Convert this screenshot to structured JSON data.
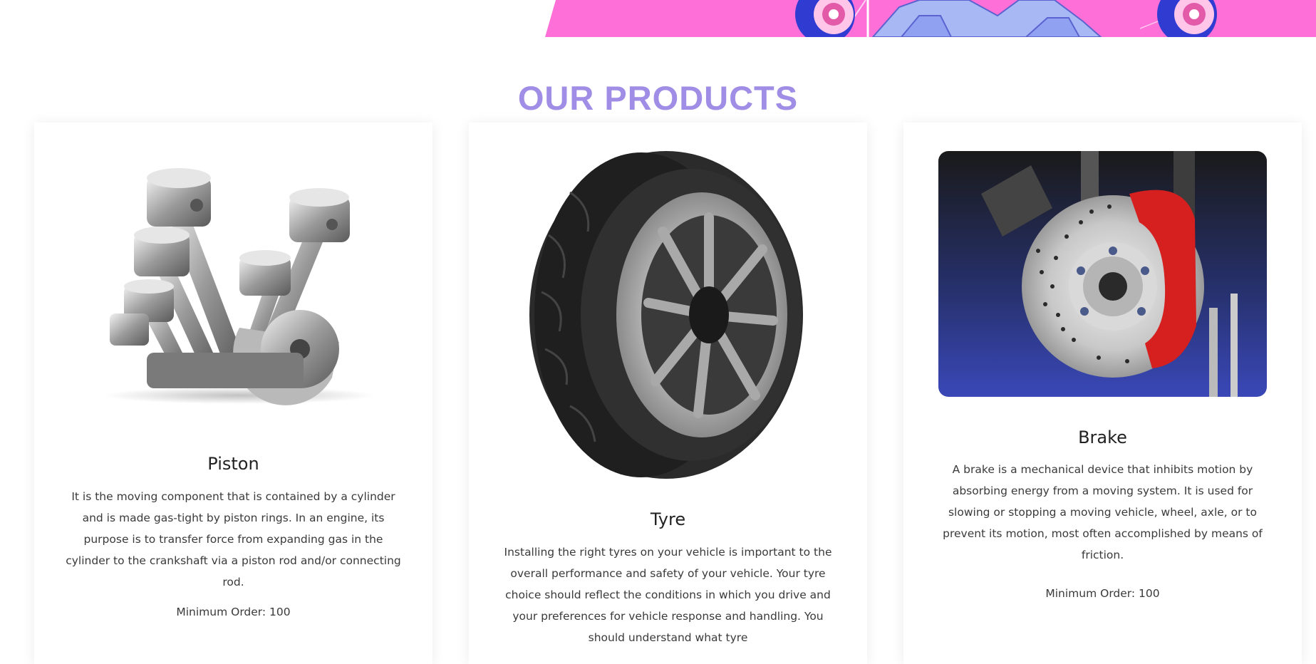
{
  "section": {
    "title": "OUR PRODUCTS"
  },
  "products": [
    {
      "name": "Piston",
      "description": "It is the moving component that is contained by a cylinder and is made gas-tight by piston rings. In an engine, its purpose is to transfer force from expanding gas in the cylinder to the crankshaft via a piston rod and/or connecting rod.",
      "order": "Minimum Order: 100"
    },
    {
      "name": "Tyre",
      "description": "Installing the right tyres on your vehicle is important to the overall performance and safety of your vehicle. Your tyre choice should reflect the conditions in which you drive and your preferences for vehicle response and handling. You should understand what tyre"
    },
    {
      "name": "Brake",
      "description": "A brake is a mechanical device that inhibits motion by absorbing energy from a moving system. It is used for slowing or stopping a moving vehicle, wheel, axle, or to prevent its motion, most often accomplished by means of friction.",
      "order": "Minimum Order: 100"
    }
  ],
  "colors": {
    "accent": "#a08ee6",
    "banner_pink": "#ff6fd8",
    "banner_blue": "#a8b8f5"
  }
}
